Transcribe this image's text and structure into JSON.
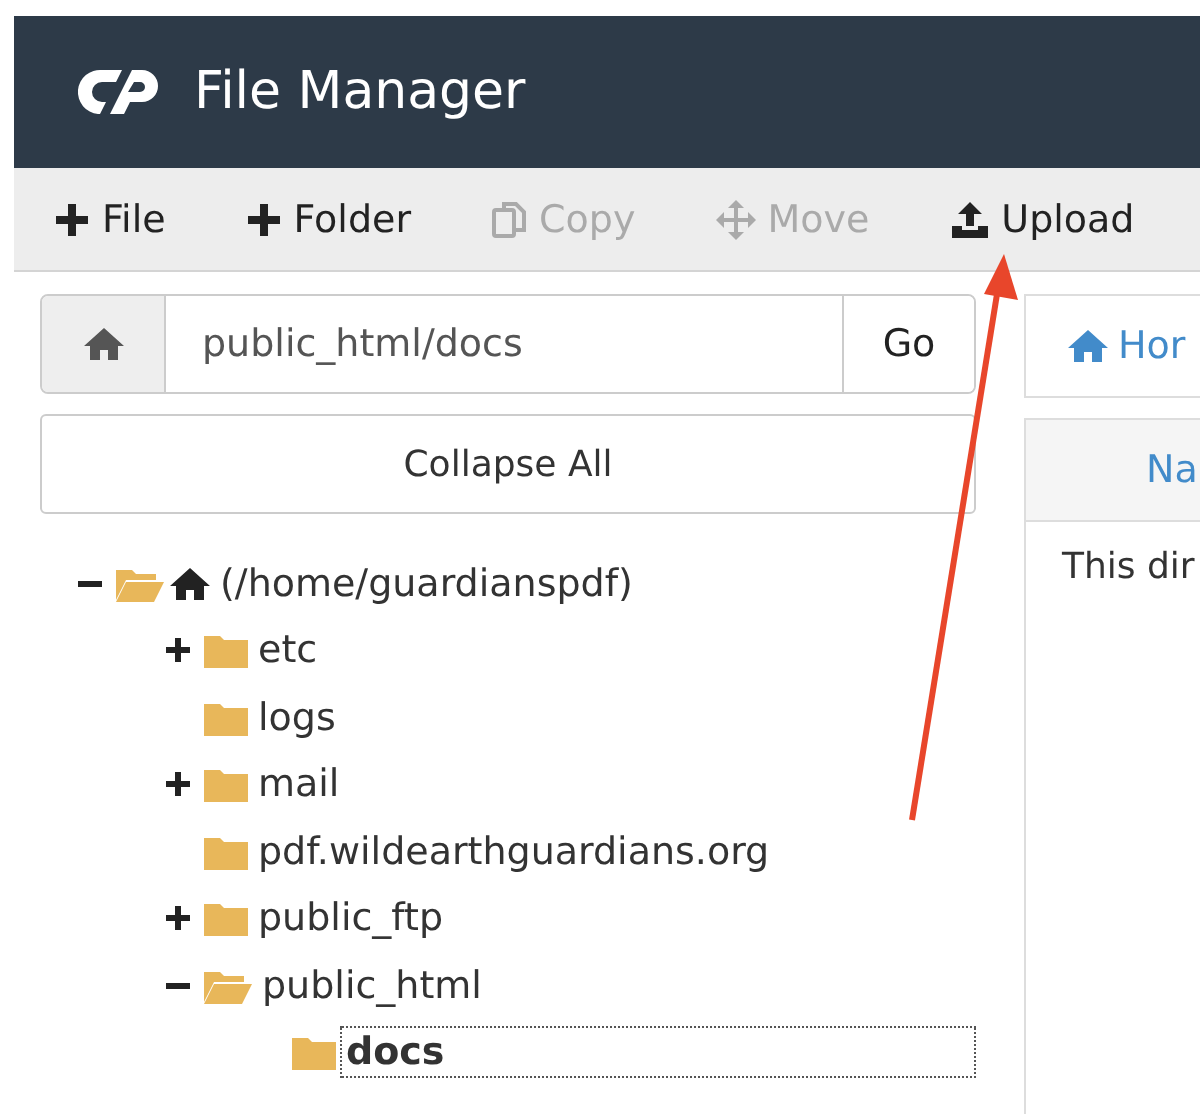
{
  "header": {
    "title": "File Manager"
  },
  "toolbar": [
    {
      "label": "File",
      "disabled": false
    },
    {
      "label": "Folder",
      "disabled": false
    },
    {
      "label": "Copy",
      "disabled": true
    },
    {
      "label": "Move",
      "disabled": true
    },
    {
      "label": "Upload",
      "disabled": false
    }
  ],
  "path_bar": {
    "value": "public_html/docs",
    "go": "Go"
  },
  "collapse_button": "Collapse All",
  "tree": [
    {
      "label": "(/home/guardianspdf)",
      "kind": "home",
      "expandable": true,
      "expanded": true,
      "selected": false,
      "children": [
        {
          "label": "etc",
          "kind": "folder",
          "expandable": true,
          "expanded": false,
          "selected": false
        },
        {
          "label": "logs",
          "kind": "folder",
          "expandable": false,
          "expanded": false,
          "selected": false
        },
        {
          "label": "mail",
          "kind": "folder",
          "expandable": true,
          "expanded": false,
          "selected": false
        },
        {
          "label": "pdf.wildearthguardians.org",
          "kind": "folder",
          "expandable": false,
          "expanded": false,
          "selected": false
        },
        {
          "label": "public_ftp",
          "kind": "folder",
          "expandable": true,
          "expanded": false,
          "selected": false
        },
        {
          "label": "public_html",
          "kind": "folder",
          "expandable": true,
          "expanded": true,
          "selected": false,
          "children": [
            {
              "label": "docs",
              "kind": "folder",
              "expandable": false,
              "expanded": false,
              "selected": true
            }
          ]
        }
      ]
    }
  ],
  "right_panel": {
    "breadcrumb": "Hor",
    "column_header": "Na",
    "message": "This dir"
  }
}
